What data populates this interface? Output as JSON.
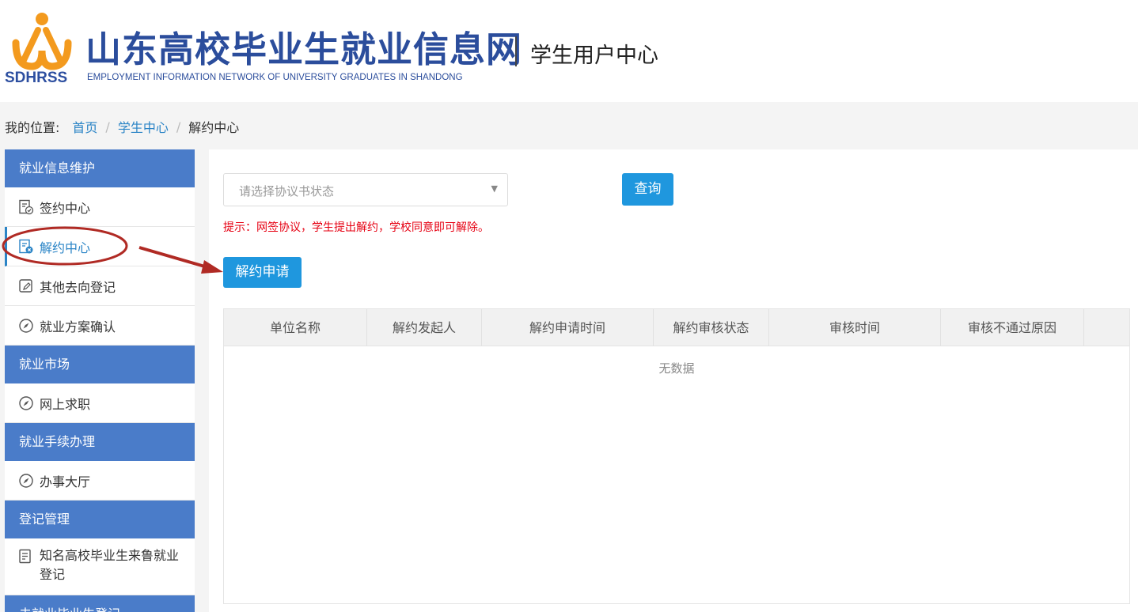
{
  "header": {
    "logo_abbr": "SDHRSS",
    "site_title": "山东高校毕业生就业信息网",
    "site_subtitle": "EMPLOYMENT INFORMATION NETWORK OF UNIVERSITY GRADUATES IN SHANDONG",
    "center_title": "学生用户中心"
  },
  "breadcrumb": {
    "label": "我的位置:",
    "items": [
      "首页",
      "学生中心",
      "解约中心"
    ],
    "separator": "/"
  },
  "sidebar": {
    "groups": [
      {
        "title": "就业信息维护",
        "items": [
          {
            "label": "签约中心",
            "icon": "contract-doc-icon"
          },
          {
            "label": "解约中心",
            "icon": "cancel-doc-icon",
            "active": true
          },
          {
            "label": "其他去向登记",
            "icon": "edit-register-icon"
          },
          {
            "label": "就业方案确认",
            "icon": "compass-icon"
          }
        ]
      },
      {
        "title": "就业市场",
        "items": [
          {
            "label": "网上求职",
            "icon": "compass-icon"
          }
        ]
      },
      {
        "title": "就业手续办理",
        "items": [
          {
            "label": "办事大厅",
            "icon": "compass-icon"
          }
        ]
      },
      {
        "title": "登记管理",
        "items": [
          {
            "label": "知名高校毕业生来鲁就业登记",
            "icon": "form-doc-icon"
          }
        ]
      },
      {
        "title": "未就业毕业生登记",
        "items": []
      }
    ]
  },
  "filter": {
    "status_placeholder": "请选择协议书状态",
    "query_label": "查询"
  },
  "tip": "提示：网签协议，学生提出解约，学校同意即可解除。",
  "apply_label": "解约申请",
  "table": {
    "columns": [
      "单位名称",
      "解约发起人",
      "解约申请时间",
      "解约审核状态",
      "审核时间",
      "审核不通过原因",
      ""
    ],
    "rows": [],
    "empty_text": "无数据"
  },
  "colors": {
    "brand_blue": "#2b4d9c",
    "sidebar_head": "#4a7cc9",
    "link": "#2a84c6",
    "button": "#1f97de",
    "tip_red": "#e60012",
    "annotation_red": "#b02a24",
    "logo_orange": "#f39a1e"
  }
}
